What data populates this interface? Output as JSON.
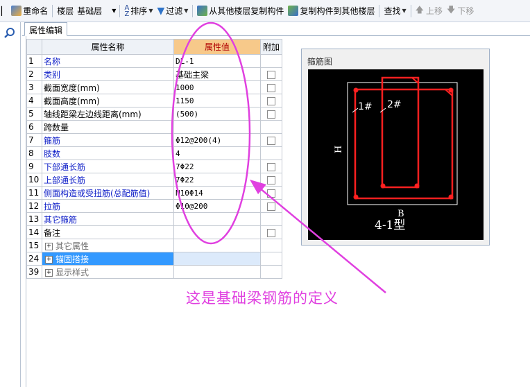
{
  "toolbar": {
    "rename_label": "重命名",
    "floor_label": "楼层",
    "floor_value": "基础层",
    "sort_label": "排序",
    "filter_label": "过滤",
    "copy_from_label": "从其他楼层复制构件",
    "copy_to_label": "复制构件到其他楼层",
    "find_label": "查找",
    "move_up_label": "上移",
    "move_down_label": "下移"
  },
  "tab": {
    "label": "属性编辑"
  },
  "grid": {
    "headers": {
      "name": "属性名称",
      "value": "属性值",
      "extra": "附加"
    },
    "rows": [
      {
        "num": "1",
        "name": "名称",
        "value": "DL-1",
        "check": false
      },
      {
        "num": "2",
        "name": "类别",
        "value": "基础主梁",
        "check": true
      },
      {
        "num": "3",
        "name": "截面宽度(mm)",
        "value": "1000",
        "check": true
      },
      {
        "num": "4",
        "name": "截面高度(mm)",
        "value": "1150",
        "check": true
      },
      {
        "num": "5",
        "name": "轴线距梁左边线距离(mm)",
        "value": "(500)",
        "check": true
      },
      {
        "num": "6",
        "name": "跨数量",
        "value": "",
        "check": false
      },
      {
        "num": "7",
        "name": "箍筋",
        "value": "Φ12@200(4)",
        "check": true
      },
      {
        "num": "8",
        "name": "肢数",
        "value": "4",
        "check": false
      },
      {
        "num": "9",
        "name": "下部通长筋",
        "value": "7Φ22",
        "check": true
      },
      {
        "num": "10",
        "name": "上部通长筋",
        "value": "7Φ22",
        "check": true
      },
      {
        "num": "11",
        "name": "侧面构造或受扭筋(总配筋值)",
        "value": "N10Φ14",
        "check": true
      },
      {
        "num": "12",
        "name": "拉筋",
        "value": "Φ10@200",
        "check": true
      },
      {
        "num": "13",
        "name": "其它箍筋",
        "value": "",
        "check": false
      },
      {
        "num": "14",
        "name": "备注",
        "value": "",
        "check": true
      },
      {
        "num": "15",
        "name": "其它属性",
        "value": "",
        "check": false
      },
      {
        "num": "24",
        "name": "锚固搭接",
        "value": "",
        "check": false
      },
      {
        "num": "39",
        "name": "显示样式",
        "value": "",
        "check": false
      }
    ]
  },
  "stirrup": {
    "title": "箍筋图",
    "label_1": "1#",
    "label_2": "2#",
    "label_h": "H",
    "label_b": "B",
    "type_label": "4-1型"
  },
  "annotation": {
    "text": "这是基础梁钢筋的定义"
  },
  "colors": {
    "highlight": "#e040e0",
    "rebar": "#ff2020",
    "selection": "#3399ff"
  }
}
